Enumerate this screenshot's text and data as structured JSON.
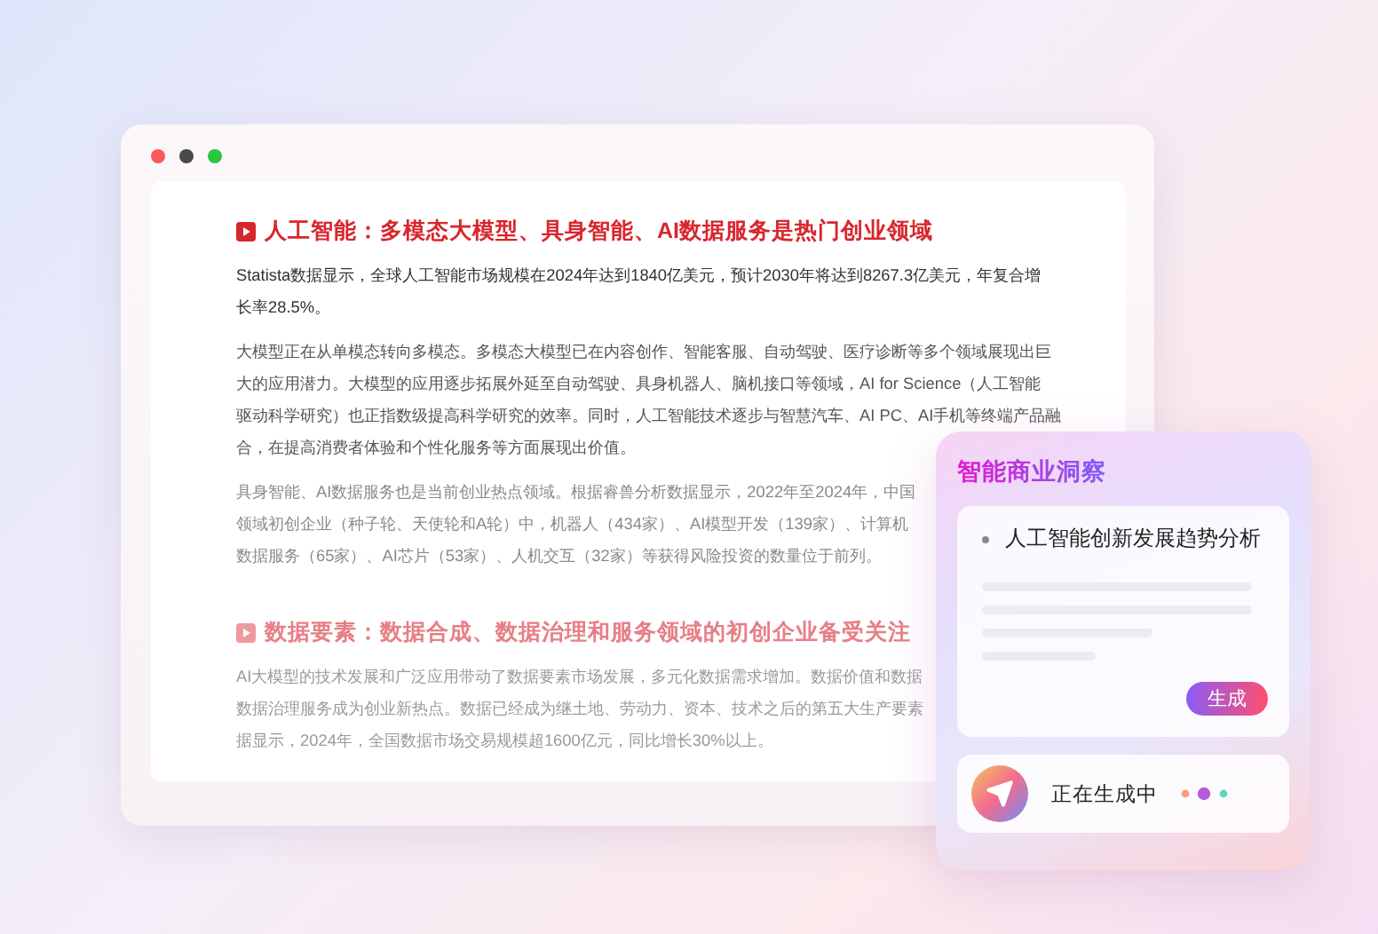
{
  "article": {
    "sections": [
      {
        "heading": "人工智能：多模态大模型、具身智能、AI数据服务是热门创业领域",
        "paragraphs": [
          {
            "lines": [
              "Statista数据显示，全球人工智能市场规模在2024年达到1840亿美元，预计2030年将达到8267.3亿美元，年复合增",
              "长率28.5%。"
            ]
          },
          {
            "lines": [
              "大模型正在从单模态转向多模态。多模态大模型已在内容创作、智能客服、自动驾驶、医疗诊断等多个领域展现出巨",
              "大的应用潜力。大模型的应用逐步拓展外延至自动驾驶、具身机器人、脑机接口等领域，AI for Science（人工智能",
              "驱动科学研究）也正指数级提高科学研究的效率。同时，人工智能技术逐步与智慧汽车、AI PC、AI手机等终端产品融",
              "合，在提高消费者体验和个性化服务等方面展现出价值。"
            ]
          },
          {
            "lines": [
              "具身智能、AI数据服务也是当前创业热点领域。根据睿兽分析数据显示，2022年至2024年，中国",
              "领域初创企业（种子轮、天使轮和A轮）中，机器人（434家）、AI模型开发（139家）、计算机",
              "数据服务（65家）、AI芯片（53家）、人机交互（32家）等获得风险投资的数量位于前列。"
            ]
          }
        ]
      },
      {
        "heading": "数据要素：数据合成、数据治理和服务领域的初创企业备受关注",
        "paragraphs": [
          {
            "lines": [
              "AI大模型的技术发展和广泛应用带动了数据要素市场发展，多元化数据需求增加。数据价值和数据",
              "数据治理服务成为创业新热点。数据已经成为继土地、劳动力、资本、技术之后的第五大生产要素",
              "据显示，2024年，全国数据市场交易规模超1600亿元，同比增长30%以上。"
            ]
          }
        ]
      }
    ]
  },
  "panel": {
    "title": "智能商业洞察",
    "topic": "人工智能创新发展趋势分析",
    "generate_button": "生成",
    "status": "正在生成中"
  }
}
